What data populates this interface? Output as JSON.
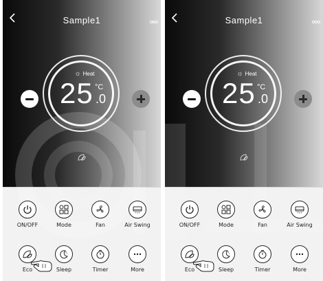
{
  "screens": [
    {
      "header": {
        "back_icon": "chevron-left-icon",
        "title": "Sample1",
        "menu_icon": "more-dots-icon"
      },
      "display": {
        "mode_label": "Heat",
        "mode_icon": "sun-icon",
        "temperature": "25",
        "decimal": ".0",
        "unit": "°C"
      },
      "controls": {
        "row1": [
          {
            "label": "ON/OFF",
            "icon": "power-icon"
          },
          {
            "label": "Mode",
            "icon": "mode-grid-icon"
          },
          {
            "label": "Fan",
            "icon": "fan-icon"
          },
          {
            "label": "Air Swing",
            "icon": "air-swing-icon"
          }
        ],
        "row2": [
          {
            "label": "Eco",
            "icon": "leaf-icon"
          },
          {
            "label": "Sleep",
            "icon": "moon-icon"
          },
          {
            "label": "Timer",
            "icon": "timer-icon"
          },
          {
            "label": "More",
            "icon": "more-horizontal-icon"
          }
        ]
      },
      "pointer": {
        "icon": "hand-pointer-icon",
        "target": "Eco"
      }
    },
    {
      "header": {
        "back_icon": "chevron-left-icon",
        "title": "Sample1",
        "menu_icon": "more-dots-icon"
      },
      "display": {
        "mode_label": "Heat",
        "mode_icon": "sun-icon",
        "temperature": "25",
        "decimal": ".0",
        "unit": "°C"
      },
      "controls": {
        "row1": [
          {
            "label": "ON/OFF",
            "icon": "power-icon"
          },
          {
            "label": "Mode",
            "icon": "mode-grid-icon"
          },
          {
            "label": "Fan",
            "icon": "fan-icon"
          },
          {
            "label": "Air Swing",
            "icon": "air-swing-icon"
          }
        ],
        "row2": [
          {
            "label": "Eco",
            "icon": "leaf-icon"
          },
          {
            "label": "Sleep",
            "icon": "moon-icon"
          },
          {
            "label": "Timer",
            "icon": "timer-icon"
          },
          {
            "label": "More",
            "icon": "more-horizontal-icon"
          }
        ]
      },
      "pointer": {
        "icon": "hand-pointer-icon",
        "target": "Eco"
      }
    }
  ]
}
